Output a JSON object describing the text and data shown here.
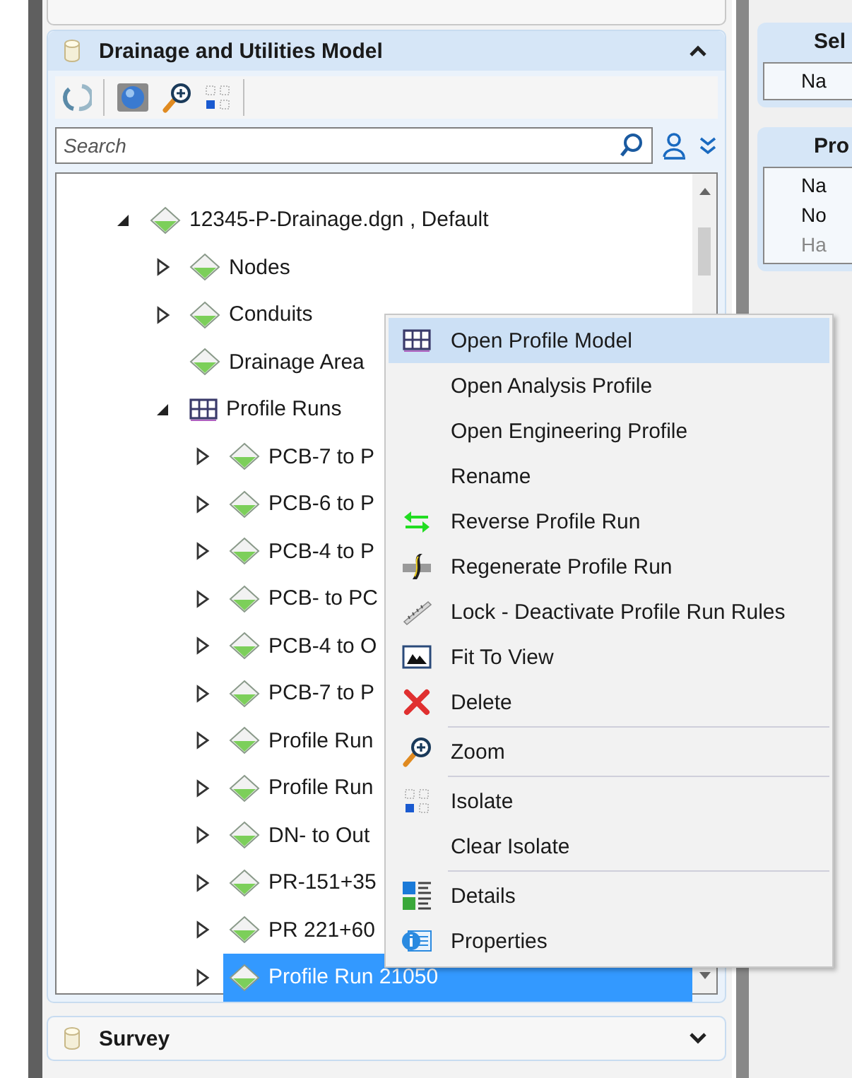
{
  "model_panel": {
    "title": "Drainage and Utilities Model",
    "expanded": true
  },
  "search": {
    "placeholder": "Search"
  },
  "tree": [
    {
      "label": "12345-P-Drainage.dgn , Default",
      "kind": "node",
      "expanded": true,
      "selected": false,
      "children": [
        {
          "label": "Nodes",
          "kind": "node",
          "expanded": false,
          "selected": false
        },
        {
          "label": "Conduits",
          "kind": "node",
          "expanded": false,
          "selected": false
        },
        {
          "label": "Drainage Area",
          "kind": "leaf",
          "selected": false
        },
        {
          "label": "Profile Runs",
          "kind": "table",
          "expanded": true,
          "selected": false,
          "children": [
            {
              "label": "PCB-7 to P",
              "kind": "node",
              "expanded": false,
              "selected": false
            },
            {
              "label": "PCB-6 to P",
              "kind": "node",
              "expanded": false,
              "selected": false
            },
            {
              "label": "PCB-4 to P",
              "kind": "node",
              "expanded": false,
              "selected": false
            },
            {
              "label": "PCB- to PC",
              "kind": "node",
              "expanded": false,
              "selected": false
            },
            {
              "label": "PCB-4 to O",
              "kind": "node",
              "expanded": false,
              "selected": false
            },
            {
              "label": "PCB-7 to P",
              "kind": "node",
              "expanded": false,
              "selected": false
            },
            {
              "label": "Profile Run",
              "kind": "node",
              "expanded": false,
              "selected": false
            },
            {
              "label": "Profile Run",
              "kind": "node",
              "expanded": false,
              "selected": false
            },
            {
              "label": "DN- to Out",
              "kind": "node",
              "expanded": false,
              "selected": false
            },
            {
              "label": "PR-151+35",
              "kind": "node",
              "expanded": false,
              "selected": false
            },
            {
              "label": "PR 221+60",
              "kind": "node",
              "expanded": false,
              "selected": false
            },
            {
              "label": "Profile Run 21050",
              "kind": "node",
              "expanded": false,
              "selected": true
            }
          ]
        }
      ]
    }
  ],
  "context_menu": {
    "items": [
      {
        "label": "Open Profile Model",
        "selected": true
      },
      {
        "label": "Open Analysis Profile",
        "selected": false
      },
      {
        "label": "Open Engineering Profile",
        "selected": false
      },
      {
        "label": "Rename",
        "selected": false
      },
      {
        "label": "Reverse Profile Run",
        "selected": false
      },
      {
        "label": "Regenerate Profile Run",
        "selected": false
      },
      {
        "label": "Lock - Deactivate Profile Run Rules",
        "selected": false
      },
      {
        "label": "Fit To View",
        "selected": false
      },
      {
        "label": "Delete",
        "selected": false
      },
      {
        "label": "Zoom",
        "selected": false
      },
      {
        "label": "Isolate",
        "selected": false
      },
      {
        "label": "Clear Isolate",
        "selected": false
      },
      {
        "label": "Details",
        "selected": false
      },
      {
        "label": "Properties",
        "selected": false
      }
    ]
  },
  "survey_panel": {
    "title": "Survey",
    "expanded": false
  },
  "properties_panel": {
    "sections": [
      {
        "title": "Sel",
        "rows": [
          {
            "label": "Na",
            "disabled": false
          }
        ]
      },
      {
        "title": "Pro",
        "rows": [
          {
            "label": "Na",
            "disabled": false
          },
          {
            "label": "No",
            "disabled": false
          },
          {
            "label": "Ha",
            "disabled": true
          }
        ]
      }
    ]
  }
}
